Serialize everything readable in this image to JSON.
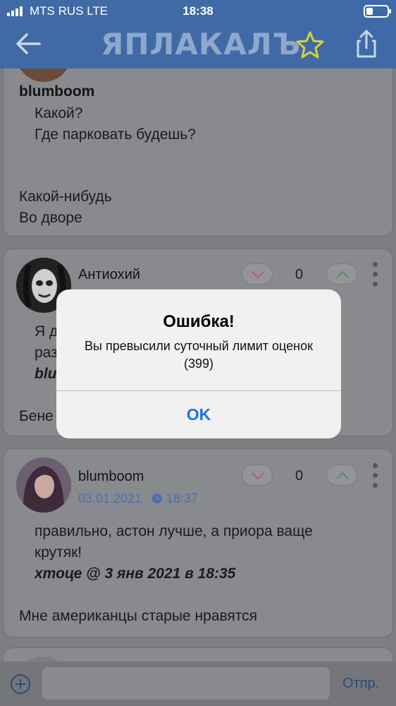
{
  "status_bar": {
    "carrier": "MTS RUS  LTE",
    "time": "18:38"
  },
  "nav": {
    "logo": "ЯПЛАКАЛЪ",
    "icons": [
      "back-arrow-icon",
      "star-icon",
      "share-icon"
    ]
  },
  "posts": [
    {
      "author": "blumboom",
      "quote_lines": [
        "Какой?",
        "Где парковать будешь?"
      ],
      "reply_lines": [
        "Какой-нибудь",
        "Во дворе"
      ]
    },
    {
      "author": "Антиохий",
      "score": "0",
      "quote_partial": [
        "Я д",
        "раз"
      ],
      "quote_author_partial": "blu",
      "reply_partial": "Бене"
    },
    {
      "author": "blumboom",
      "date": "03.01.2021",
      "time": "18:37",
      "score": "0",
      "quote_lines": [
        "правильно, астон лучше, а приора ваще",
        "крутяк!"
      ],
      "quote_source": "хтоце @ 3 янв 2021 в 18:35",
      "reply": "Мне американцы старые нравятся"
    }
  ],
  "composer": {
    "send_label": "Отпр."
  },
  "alert": {
    "title": "Ошибка!",
    "message": "Вы превысили суточный лимит оценок (399)",
    "ok_label": "OK"
  },
  "colors": {
    "nav_bg": "#3f6aa6",
    "link": "#1a73e0",
    "date_link": "#4a6fb5"
  }
}
